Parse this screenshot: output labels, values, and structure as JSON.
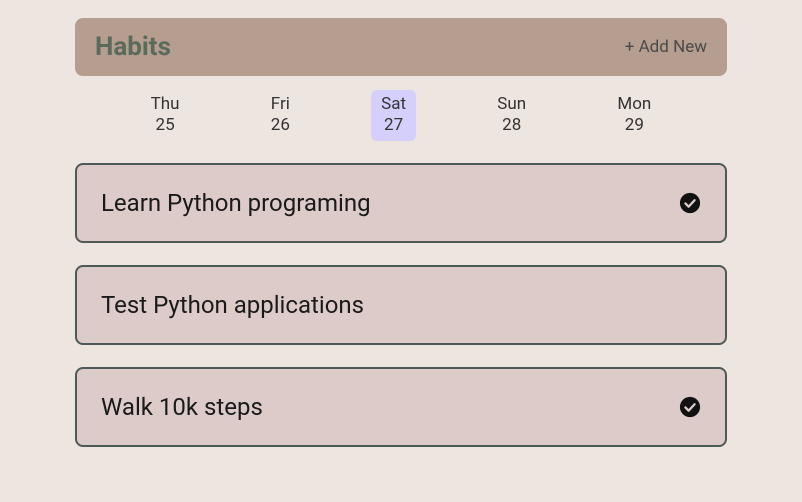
{
  "header": {
    "title": "Habits",
    "add_new_label": "+ Add New"
  },
  "days": [
    {
      "name": "Thu",
      "num": "25",
      "selected": false
    },
    {
      "name": "Fri",
      "num": "26",
      "selected": false
    },
    {
      "name": "Sat",
      "num": "27",
      "selected": true
    },
    {
      "name": "Sun",
      "num": "28",
      "selected": false
    },
    {
      "name": "Mon",
      "num": "29",
      "selected": false
    }
  ],
  "habits": [
    {
      "title": "Learn Python programing",
      "done": true
    },
    {
      "title": "Test Python applications",
      "done": false
    },
    {
      "title": "Walk 10k steps",
      "done": true
    }
  ]
}
